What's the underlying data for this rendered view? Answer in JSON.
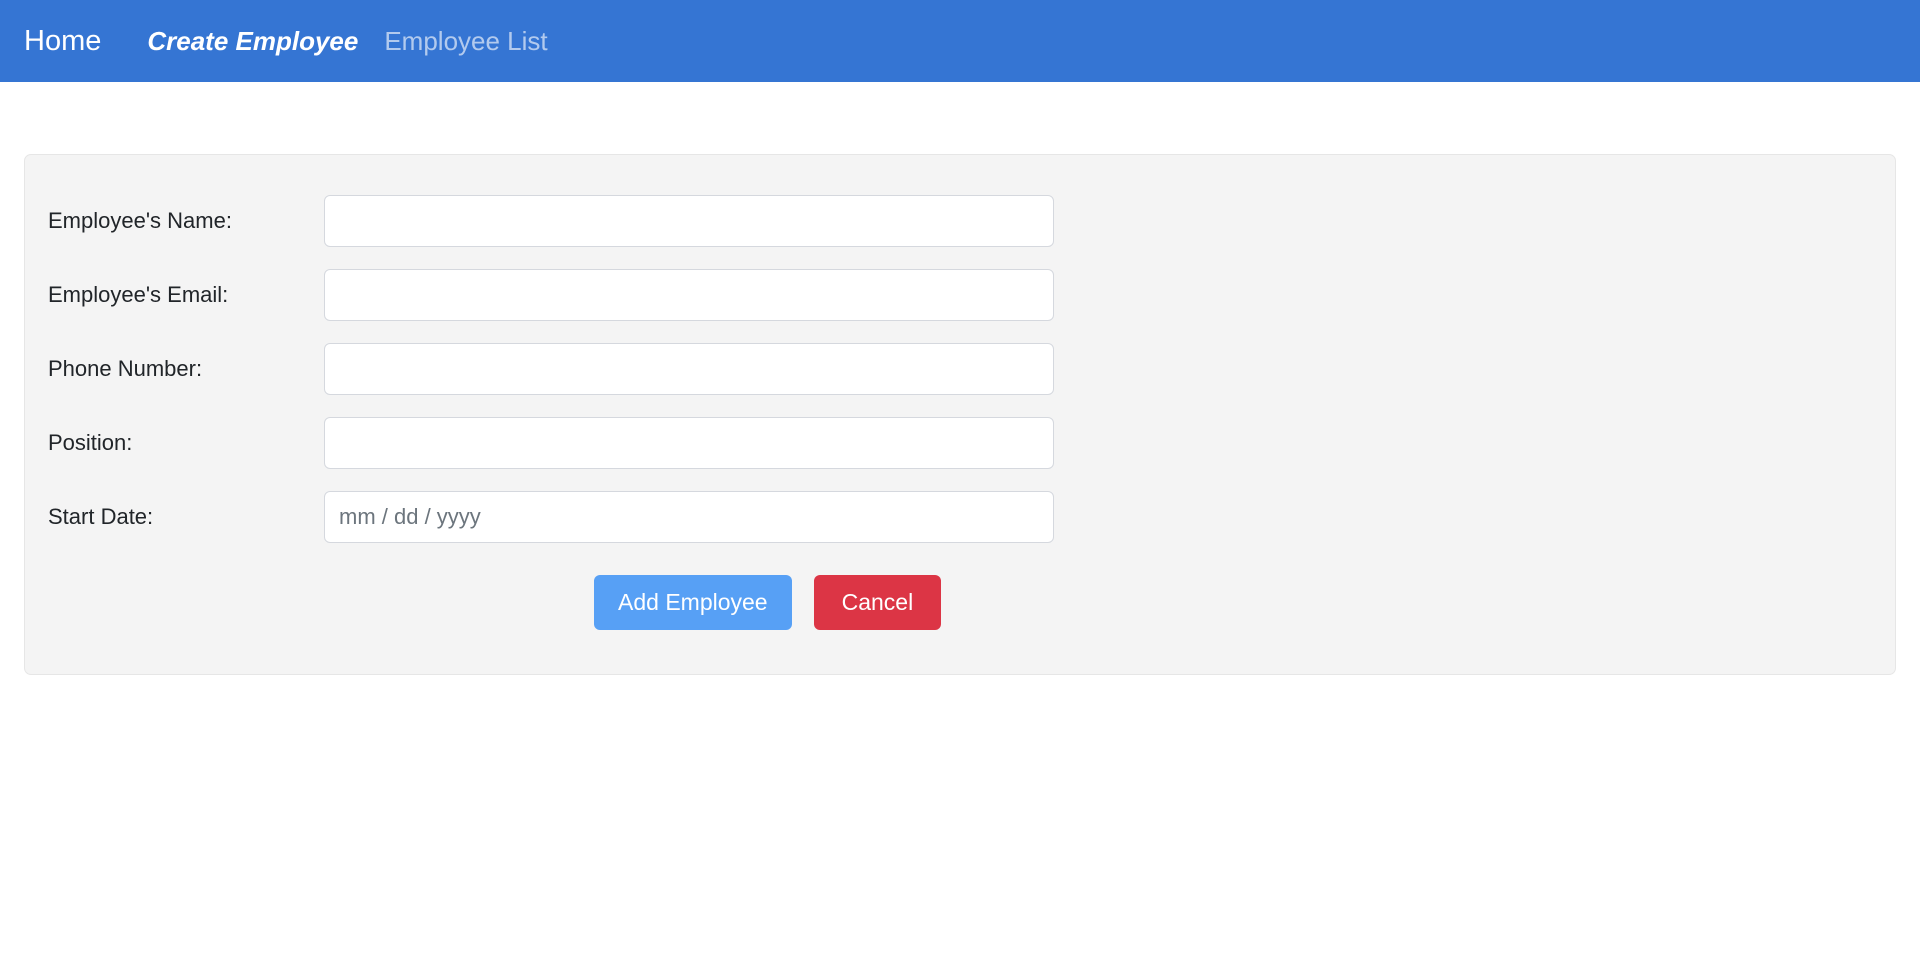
{
  "navbar": {
    "background_color": "#3575d3",
    "items": [
      {
        "label": "Home",
        "state": "normal"
      },
      {
        "label": "Create Employee",
        "state": "active"
      },
      {
        "label": "Employee List",
        "state": "muted"
      }
    ]
  },
  "form": {
    "panel_background": "#f4f4f4",
    "fields": [
      {
        "label": "Employee's Name:",
        "value": "",
        "placeholder": "",
        "type": "text"
      },
      {
        "label": "Employee's Email:",
        "value": "",
        "placeholder": "",
        "type": "email"
      },
      {
        "label": "Phone Number:",
        "value": "",
        "placeholder": "",
        "type": "tel"
      },
      {
        "label": "Position:",
        "value": "",
        "placeholder": "",
        "type": "text"
      },
      {
        "label": "Start Date:",
        "value": "",
        "placeholder": "mm / dd / yyyy",
        "type": "date"
      }
    ],
    "buttons": {
      "submit_label": "Add Employee",
      "submit_color": "#57a0f5",
      "cancel_label": "Cancel",
      "cancel_color": "#dc3545"
    }
  }
}
